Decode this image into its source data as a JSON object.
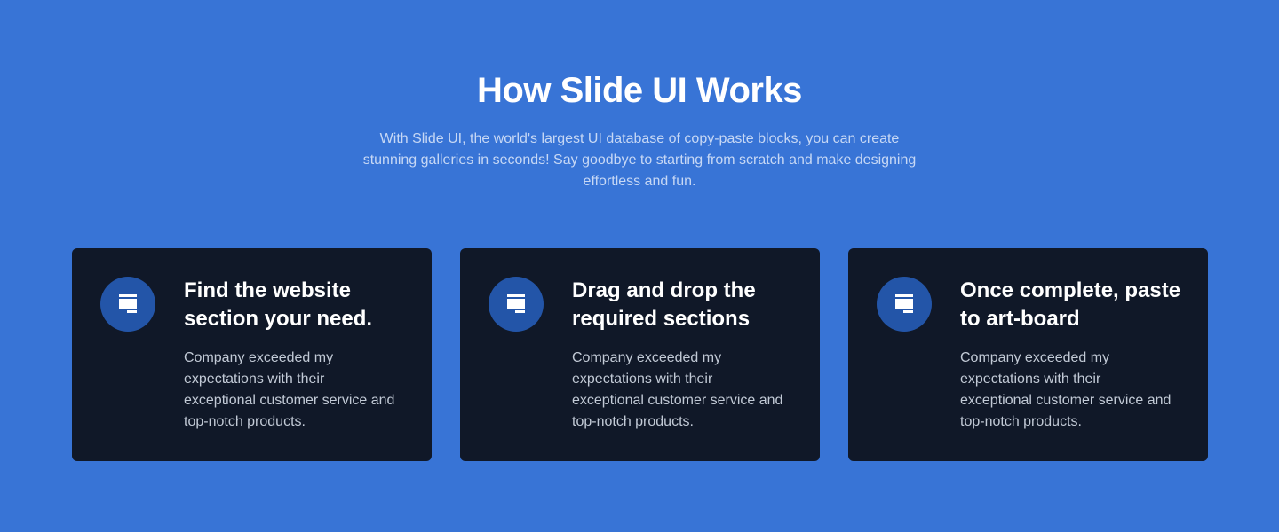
{
  "header": {
    "title": "How Slide UI Works",
    "subtitle": "With Slide UI, the world's largest UI database of copy-paste blocks, you can create stunning galleries in seconds! Say goodbye to starting from scratch and make designing effortless and fun."
  },
  "colors": {
    "background": "#3874d6",
    "card": "#101828",
    "icon_circle": "#2355a8"
  },
  "cards": [
    {
      "icon": "layout-icon",
      "title": "Find the website section your need.",
      "description": "Company exceeded my expectations with their exceptional customer service and top-notch products."
    },
    {
      "icon": "layout-icon",
      "title": "Drag and drop the required sections",
      "description": "Company exceeded my expectations with their exceptional customer service and top-notch products."
    },
    {
      "icon": "layout-icon",
      "title": "Once complete, paste to art-board",
      "description": "Company exceeded my expectations with their exceptional customer service and top-notch products."
    }
  ]
}
